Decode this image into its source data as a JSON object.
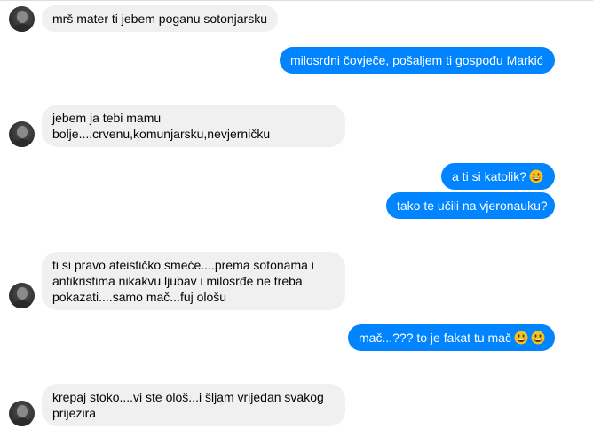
{
  "conversation": {
    "messages": [
      {
        "side": "in",
        "text": "mrš mater ti jebem poganu sotonjarsku"
      },
      {
        "side": "out",
        "text": "milosrdni čovječe, pošaljem ti gospođu Markić"
      },
      {
        "side": "in",
        "text": "jebem ja tebi mamu bolje....crvenu,komunjarsku,nevjerničku"
      },
      {
        "side": "out",
        "text": "a ti si katolik?",
        "emoji": "grinning-face-emoji"
      },
      {
        "side": "out",
        "text": "tako te učili na vjeronauku?"
      },
      {
        "side": "in",
        "text": "ti si pravo ateističko smeće....prema sotonama i antikristima nikakvu ljubav i milosrđe ne treba pokazati....samo mač...fuj ološu"
      },
      {
        "side": "out",
        "text": "mač...??? to je fakat tu mač",
        "emoji": "grinning-face-emoji x2"
      },
      {
        "side": "in",
        "text": "krepaj stoko....vi ste ološ...i šljam vrijedan svakog prijezira"
      }
    ]
  },
  "colors": {
    "outgoing_bubble": "#0084ff",
    "incoming_bubble": "#f0f0f0",
    "emoji_face": "#f7c21b"
  },
  "icons": {
    "avatar": "user-avatar-photo",
    "emoji": "grinning-face-emoji"
  }
}
